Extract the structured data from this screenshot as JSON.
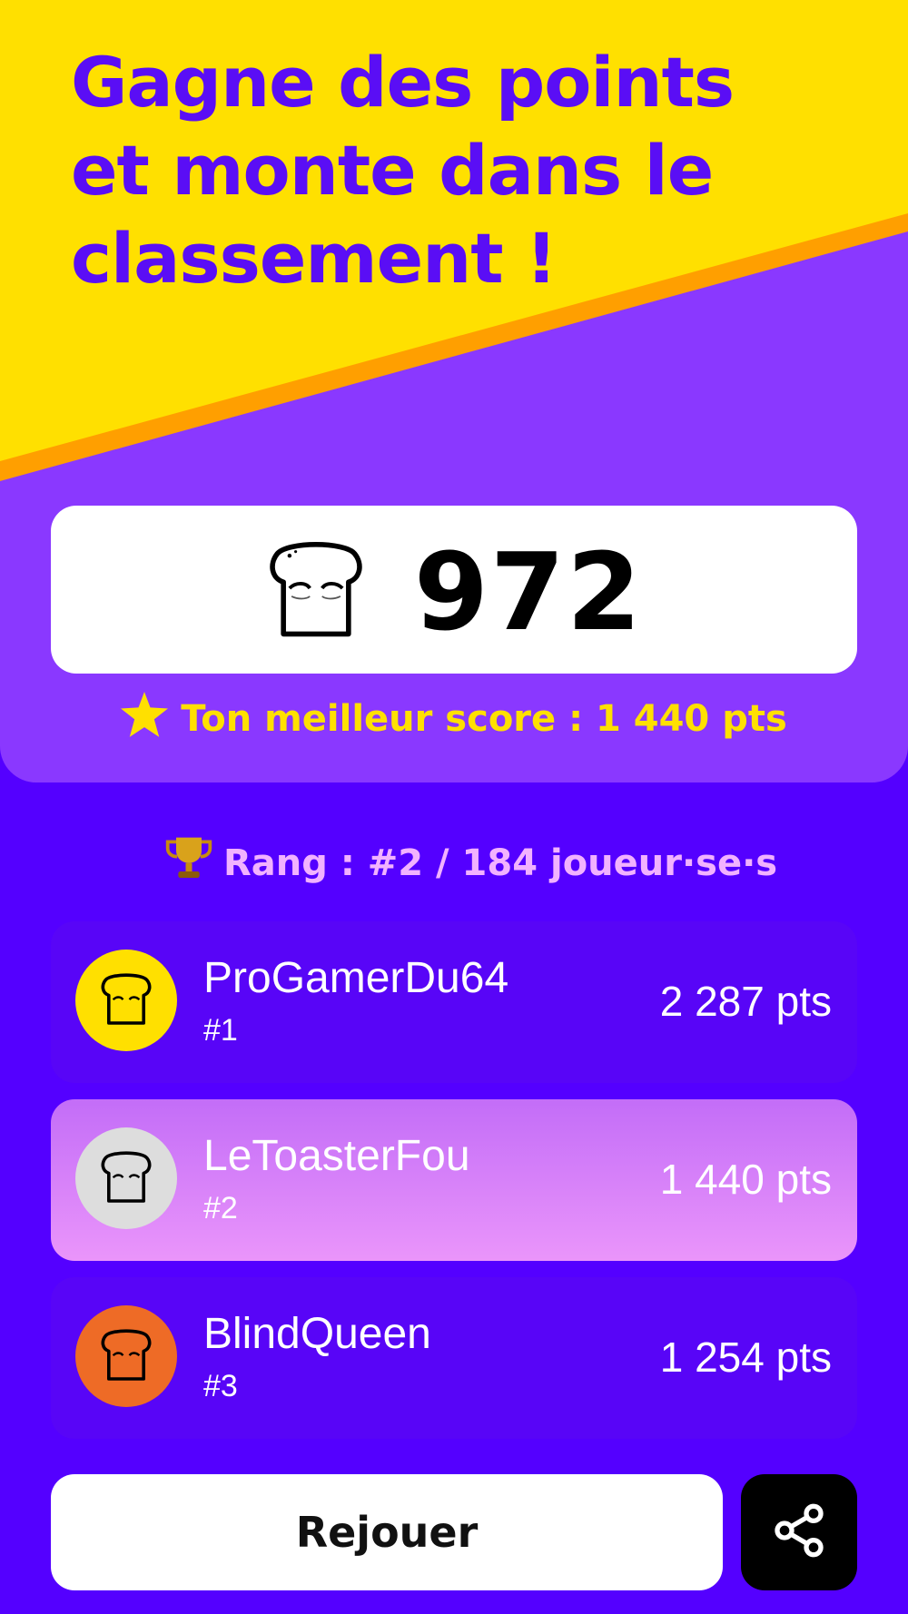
{
  "header": {
    "title_lines": [
      "Gagne des points",
      "et monte dans le",
      "classement !"
    ]
  },
  "score": {
    "current": "972",
    "icon": "toast-icon",
    "best_label": "Ton meilleur score : 1 440 pts",
    "best_icon": "star-icon"
  },
  "rank": {
    "icon": "trophy-icon",
    "label": "Rang : #2 / 184 joueur·se·s"
  },
  "leaderboard": [
    {
      "name": "ProGamerDu64",
      "rank": "#1",
      "points": "2 287 pts",
      "avatar_color": "#FFE000",
      "highlight": false
    },
    {
      "name": "LeToasterFou",
      "rank": "#2",
      "points": "1 440 pts",
      "avatar_color": "#DDDDDD",
      "highlight": true
    },
    {
      "name": "BlindQueen",
      "rank": "#3",
      "points": "1 254 pts",
      "avatar_color": "#EE6B26",
      "highlight": false
    }
  ],
  "actions": {
    "replay_label": "Rejouer",
    "share_icon": "share-icon"
  },
  "colors": {
    "background": "#5400FF",
    "panel": "#8A38FF",
    "accent_yellow": "#FFE000",
    "accent_orange": "#FF9F00",
    "title": "#5A0EF5",
    "rank_text": "#F2B2FF"
  }
}
